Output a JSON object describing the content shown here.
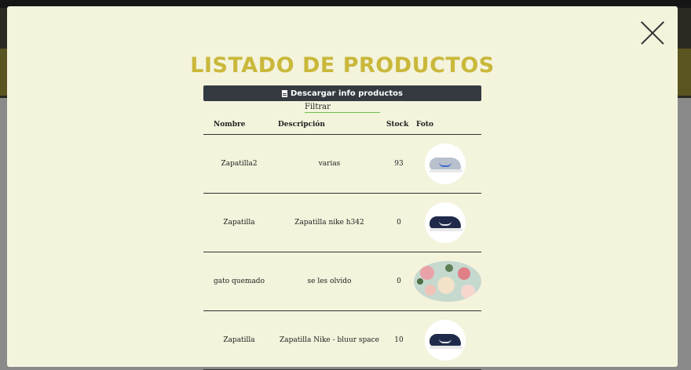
{
  "modal": {
    "title": "LISTADO DE PRODUCTOS",
    "download_label": "Descargar info productos",
    "filter_placeholder": "Filtrar"
  },
  "table": {
    "headers": [
      "Nombre",
      "Descripción",
      "Stock",
      "Foto"
    ],
    "rows": [
      {
        "nombre": "Zapatilla2",
        "descripcion": "varias",
        "stock": "93",
        "foto": "sneaker-grey-image"
      },
      {
        "nombre": "Zapatilla",
        "descripcion": "Zapatilla nike h342",
        "stock": "0",
        "foto": "sneaker-navy-image"
      },
      {
        "nombre": "gato quemado",
        "descripcion": "se les olvido",
        "stock": "0",
        "foto": "floral-pattern-image"
      },
      {
        "nombre": "Zapatilla",
        "descripcion": "Zapatilla Nike - bluur space",
        "stock": "10",
        "foto": "sneaker-navy-image"
      }
    ]
  },
  "colors": {
    "title": "#c9b83a",
    "modal_bg": "#f4f3dc",
    "button_bg": "#343a40",
    "filter_underline": "#6abf4b"
  }
}
